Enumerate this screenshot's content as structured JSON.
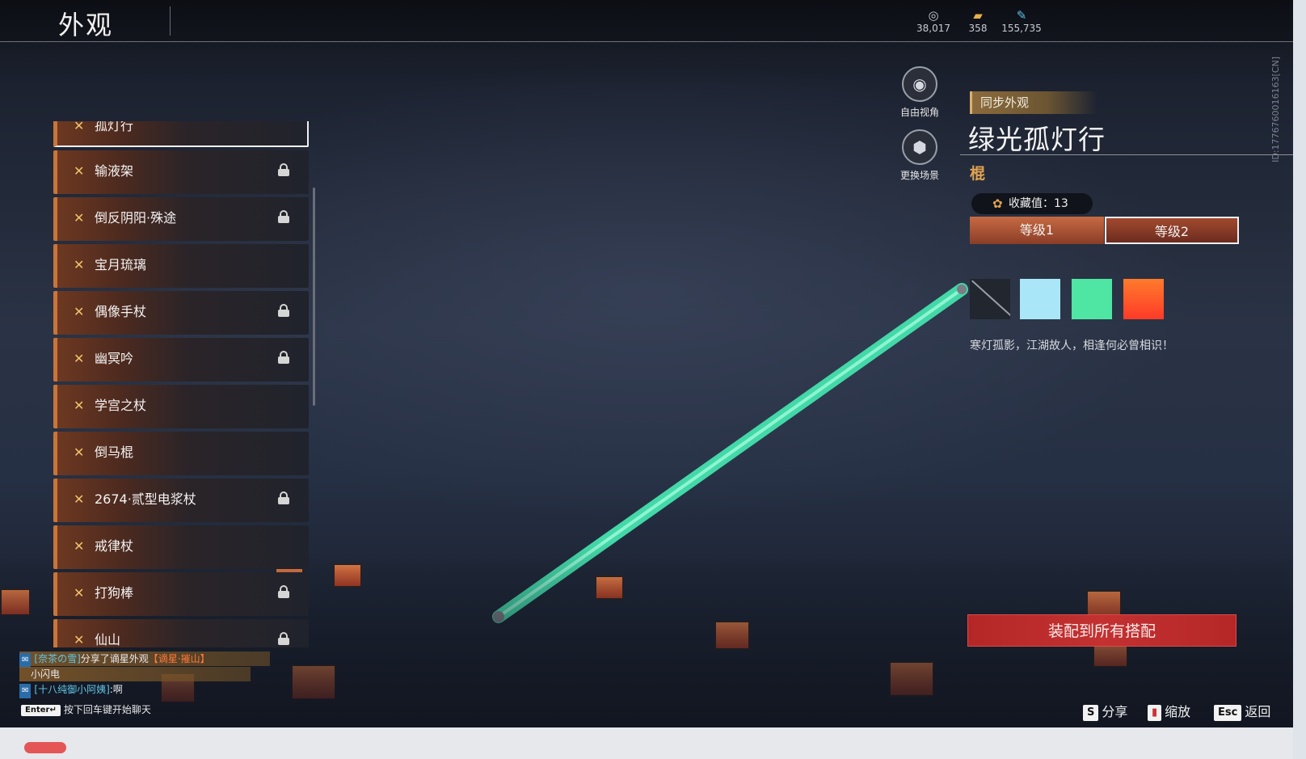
{
  "header": {
    "title": "外观",
    "currencies": [
      {
        "icon": "coin-icon",
        "value": "38,017"
      },
      {
        "icon": "ticket-icon",
        "value": "358"
      },
      {
        "icon": "feather-icon",
        "value": "155,735"
      }
    ]
  },
  "list": {
    "items": [
      {
        "label": "孤灯行",
        "locked": false,
        "selected": true
      },
      {
        "label": "输液架",
        "locked": true
      },
      {
        "label": "倒反阴阳·殊途",
        "locked": true
      },
      {
        "label": "宝月琉璃",
        "locked": false
      },
      {
        "label": "偶像手杖",
        "locked": true
      },
      {
        "label": "幽冥吟",
        "locked": true
      },
      {
        "label": "学宫之杖",
        "locked": false
      },
      {
        "label": "倒马棍",
        "locked": false
      },
      {
        "label": "2674·贰型电浆杖",
        "locked": true
      },
      {
        "label": "戒律杖",
        "locked": false
      },
      {
        "label": "打狗棒",
        "locked": true
      },
      {
        "label": "仙山",
        "locked": true
      }
    ]
  },
  "side_buttons": {
    "free_view": "自由视角",
    "change_scene": "更换场景"
  },
  "detail": {
    "sync_tag": "同步外观",
    "name": "绿光孤灯行",
    "type": "棍",
    "collect_label": "收藏值：13",
    "levels": [
      "等级1",
      "等级2"
    ],
    "swatch_colors": [
      "#a9e7f8",
      "#4fe6a4",
      "#ff3a28"
    ],
    "description": "寒灯孤影，江湖故人，相逢何必曾相识！",
    "equip_button": "装配到所有搭配"
  },
  "hints": {
    "share_key": "S",
    "share_label": "分享",
    "zoom_label": "缩放",
    "back_key": "Esc",
    "back_label": "返回"
  },
  "chat": {
    "row1_sender": "[奈茶の雪]",
    "row1_text": "分享了谪星外观",
    "row1_item": "【谪星·摧山】",
    "row2_text": "小闪电",
    "row3_sender": "[十八纯御小阿姨]",
    "row3_text": ":啊",
    "enter_key": "Enter↵",
    "enter_hint": "按下回车键开始聊天"
  },
  "id_text": "ID:1776760016163[CN]",
  "colors": {
    "accent_orange": "#c8753a",
    "staff_green": "#52e7b8",
    "equip_red": "#c33131"
  }
}
